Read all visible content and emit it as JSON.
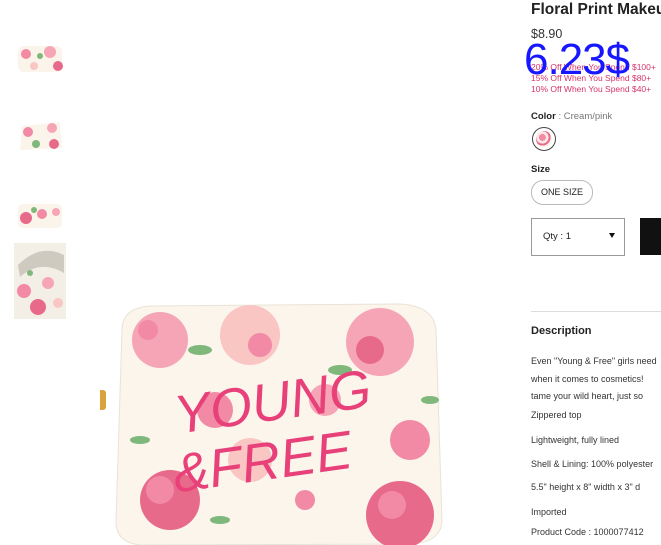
{
  "product": {
    "title": "Floral Print Makeup",
    "price": "$8.90",
    "overlay_price": "6.23$",
    "promos": [
      "20% Off When You Spend $100+",
      "15% Off When You Spend $80+",
      "10% Off When You Spend $40+"
    ],
    "color_label": "Color",
    "color_sep": " : ",
    "color_value": "Cream/pink",
    "size_label": "Size",
    "size_option": "ONE SIZE",
    "qty_label": "Qty : 1",
    "image_text": "YOUNG & FREE"
  },
  "description": {
    "title": "Description",
    "lines": [
      "Even \"Young & Free\" girls need",
      "when it comes to cosmetics!",
      "tame your wild heart, just so",
      "Zippered top",
      "Lightweight, fully lined",
      "Shell & Lining: 100% polyester",
      "5.5\" height x 8\" width x 3\" d",
      "Imported",
      "Product Code : 1000077412"
    ]
  },
  "colors": {
    "promo": "#d6336c",
    "overlay": "#1616ff",
    "flower": "#f28aa5",
    "lettering": "#e8417a"
  }
}
